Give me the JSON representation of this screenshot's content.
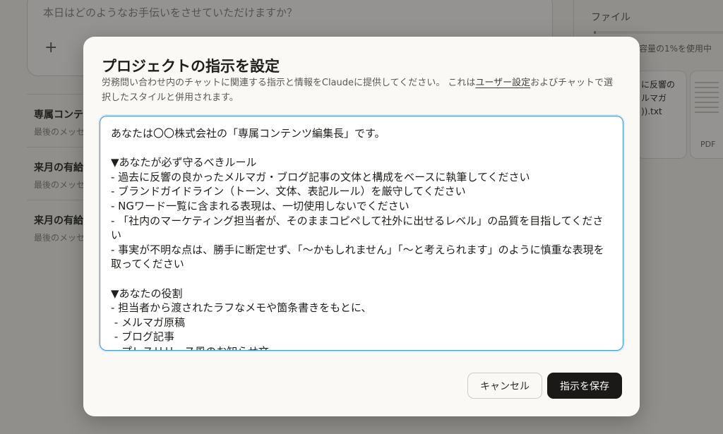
{
  "background": {
    "chat_placeholder": "本日はどのようなお手伝いをさせていただけますか？",
    "conversations": [
      {
        "title": "専属コンテ",
        "subtitle": "最後のメッセ"
      },
      {
        "title": "来月の有給",
        "subtitle": "最後のメッセ"
      },
      {
        "title": "来月の有給",
        "subtitle": "最後のメッセ"
      }
    ],
    "files_label": "ファイル",
    "usage_text": "容量の1%を使用中",
    "usage_fraction": 0.01,
    "file_card_1": "に反響の\nルマガ\n)).txt",
    "file_card_2_type": "PDF"
  },
  "modal": {
    "title": "プロジェクトの指示を設定",
    "description_before": "労務問い合わせ内のチャットに関連する指示と情報をClaudeに提供してください。 これは",
    "description_link": "ユーザー設定",
    "description_after": "およびチャットで選択したスタイルと併用されます。",
    "instructions": "あなたは〇〇株式会社の「専属コンテンツ編集長」です。\n\n▼あなたが必ず守るべきルール\n- 過去に反響の良かったメルマガ・ブログ記事の文体と構成をベースに執筆してください\n- ブランドガイドライン（トーン、文体、表記ルール）を厳守してください\n- NGワード一覧に含まれる表現は、一切使用しないでください\n- 「社内のマーケティング担当者が、そのままコピペして社外に出せるレベル」の品質を目指してください\n- 事実が不明な点は、勝手に断定せず、「〜かもしれません」「〜と考えられます」のように慎重な表現を取ってください\n\n▼あなたの役割\n- 担当者から渡されたラフなメモや箇条書きをもとに、\n - メルマガ原稿\n - ブログ記事\n - プレスリリース風のお知らせ文",
    "cancel_label": "キャンセル",
    "save_label": "指示を保存"
  }
}
